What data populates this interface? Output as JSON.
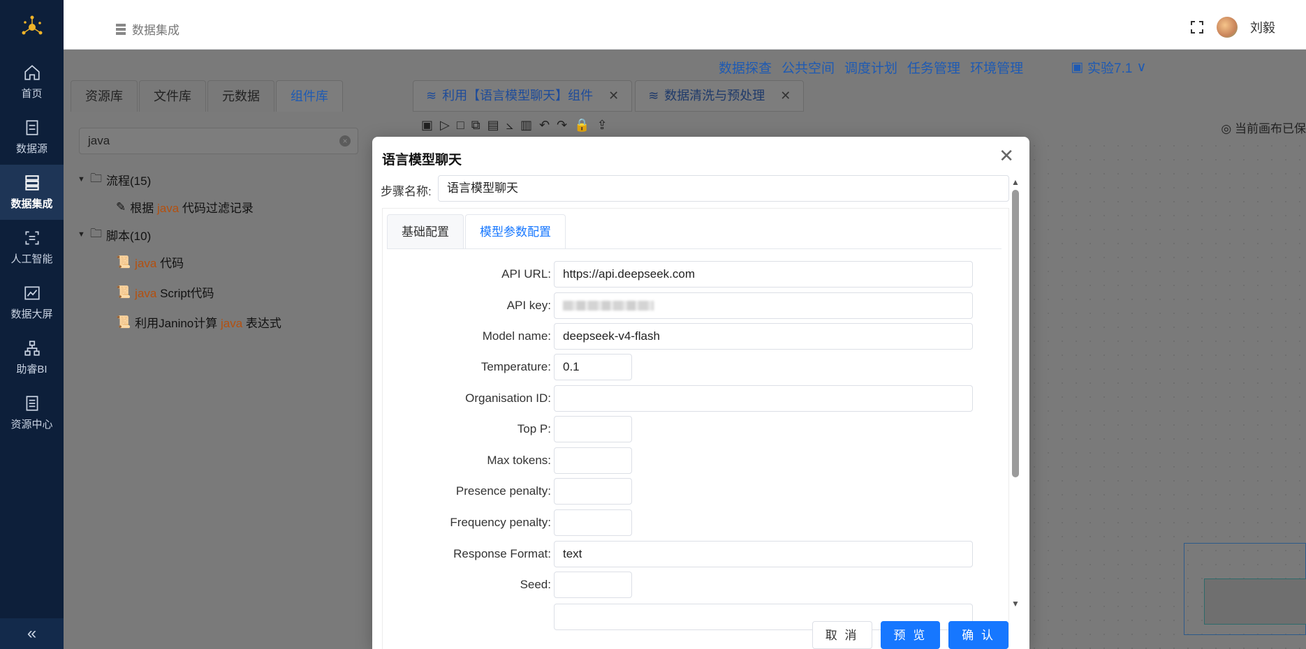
{
  "sidebar": {
    "items": [
      {
        "label": "首页",
        "icon": "home-icon"
      },
      {
        "label": "数据源",
        "icon": "database-icon"
      },
      {
        "label": "数据集成",
        "icon": "integration-icon",
        "active": true
      },
      {
        "label": "人工智能",
        "icon": "ai-icon"
      },
      {
        "label": "数据大屏",
        "icon": "chart-icon"
      },
      {
        "label": "助睿BI",
        "icon": "org-chart-icon"
      },
      {
        "label": "资源中心",
        "icon": "resource-icon"
      }
    ],
    "collapse_label": "«"
  },
  "header": {
    "breadcrumb": "数据集成",
    "user_name": "刘毅"
  },
  "menu_links": [
    "数据探查",
    "公共空间",
    "调度计划",
    "任务管理",
    "环境管理"
  ],
  "experiment_label": "实验7.1",
  "left_panel": {
    "tabs": [
      "资源库",
      "文件库",
      "元数据",
      "组件库"
    ],
    "active_tab": "组件库",
    "search_value": "java",
    "tree": {
      "group1": {
        "label": "流程(15)",
        "children": [
          {
            "pre": "根据 ",
            "hl": "java",
            "post": " 代码过滤记录"
          }
        ]
      },
      "group2": {
        "label": "脚本(10)",
        "children": [
          {
            "pre": "",
            "hl": "java",
            "post": " 代码"
          },
          {
            "pre": "",
            "hl": "java",
            "post": " Script代码"
          },
          {
            "pre": "利用Janino计算 ",
            "hl": "java",
            "post": " 表达式"
          }
        ]
      }
    }
  },
  "canvas": {
    "tabs": [
      {
        "label": "利用【语言模型聊天】组件"
      },
      {
        "label": "数据清洗与预处理"
      }
    ],
    "saved_status": "当前画布已保"
  },
  "modal": {
    "title": "语言模型聊天",
    "step_name_label": "步骤名称:",
    "step_name_value": "语言模型聊天",
    "tabs": [
      "基础配置",
      "模型参数配置"
    ],
    "fields": {
      "api_url": {
        "label": "API URL:",
        "value": "https://api.deepseek.com"
      },
      "api_key": {
        "label": "API key:"
      },
      "model_name": {
        "label": "Model name:",
        "value": "deepseek-v4-flash"
      },
      "temperature": {
        "label": "Temperature:",
        "value": "0.1"
      },
      "org_id": {
        "label": "Organisation ID:",
        "value": ""
      },
      "top_p": {
        "label": "Top P:",
        "value": ""
      },
      "max_tokens": {
        "label": "Max tokens:",
        "value": ""
      },
      "presence_penalty": {
        "label": "Presence penalty:",
        "value": ""
      },
      "frequency_penalty": {
        "label": "Frequency penalty:",
        "value": ""
      },
      "response_format": {
        "label": "Response Format:",
        "value": "text"
      },
      "seed": {
        "label": "Seed:",
        "value": ""
      }
    },
    "buttons": {
      "cancel": "取 消",
      "preview": "预 览",
      "confirm": "确 认"
    }
  },
  "colors": {
    "sidebar_bg": "#0d1f3a",
    "primary": "#1677ff",
    "highlight": "#b4500f"
  }
}
